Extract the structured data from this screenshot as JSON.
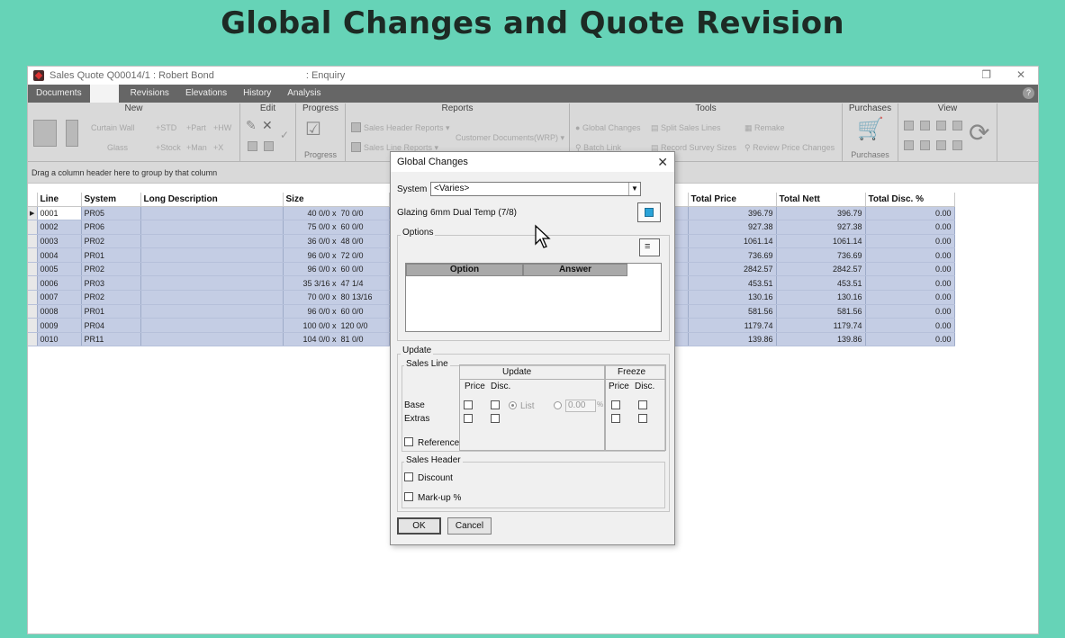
{
  "slide": {
    "title": "Global Changes and Quote Revision"
  },
  "window": {
    "title": "Sales Quote Q00014/1 : Robert Bond",
    "mode": ": Enquiry"
  },
  "menu": [
    "Documents",
    "",
    "Revisions",
    "Elevations",
    "History",
    "Analysis"
  ],
  "ribbon": {
    "new": {
      "header": "New",
      "curtain_wall": "Curtain Wall",
      "std": "+STD",
      "part": "+Part",
      "hw": "+HW",
      "glass": "Glass",
      "stock": "+Stock",
      "man": "+Man",
      "x": "+X"
    },
    "edit": {
      "header": "Edit"
    },
    "progress": {
      "header": "Progress",
      "footer": "Progress"
    },
    "reports": {
      "header": "Reports",
      "sales_header_reports": "Sales Header Reports ▾",
      "customer_documents": "Customer Documents(WRP) ▾",
      "sales_line_reports": "Sales Line Reports ▾"
    },
    "tools": {
      "header": "Tools",
      "global_changes": "Global Changes",
      "split_sales_lines": "Split Sales Lines",
      "remake": "Remake",
      "batch_link": "Batch Link",
      "record_survey_sizes": "Record Survey Sizes",
      "review_price_changes": "Review Price Changes"
    },
    "purchases": {
      "header": "Purchases",
      "footer": "Purchases"
    },
    "view": {
      "header": "View"
    }
  },
  "grid": {
    "group_hint": "Drag a column header here to group by that column",
    "columns": [
      "Line",
      "System",
      "Long Description",
      "Size",
      "Total Price",
      "Total Nett",
      "Total Disc. %"
    ],
    "rows": [
      {
        "line": "0001",
        "system": "PR05",
        "size_w": "40 0/0 x",
        "size_h": "70 0/0",
        "price": "396.79",
        "nett": "396.79",
        "disc": "0.00"
      },
      {
        "line": "0002",
        "system": "PR06",
        "size_w": "75 0/0 x",
        "size_h": "60 0/0",
        "price": "927.38",
        "nett": "927.38",
        "disc": "0.00"
      },
      {
        "line": "0003",
        "system": "PR02",
        "size_w": "36 0/0 x",
        "size_h": "48 0/0",
        "price": "1061.14",
        "nett": "1061.14",
        "disc": "0.00"
      },
      {
        "line": "0004",
        "system": "PR01",
        "size_w": "96 0/0 x",
        "size_h": "72 0/0",
        "price": "736.69",
        "nett": "736.69",
        "disc": "0.00"
      },
      {
        "line": "0005",
        "system": "PR02",
        "size_w": "96 0/0 x",
        "size_h": "60 0/0",
        "price": "2842.57",
        "nett": "2842.57",
        "disc": "0.00"
      },
      {
        "line": "0006",
        "system": "PR03",
        "size_w": "35 3/16 x",
        "size_h": "47 1/4",
        "price": "453.51",
        "nett": "453.51",
        "disc": "0.00"
      },
      {
        "line": "0007",
        "system": "PR02",
        "size_w": "70 0/0 x",
        "size_h": "80 13/16",
        "price": "130.16",
        "nett": "130.16",
        "disc": "0.00"
      },
      {
        "line": "0008",
        "system": "PR01",
        "size_w": "96 0/0 x",
        "size_h": "60 0/0",
        "price": "581.56",
        "nett": "581.56",
        "disc": "0.00"
      },
      {
        "line": "0009",
        "system": "PR04",
        "size_w": "100 0/0 x",
        "size_h": "120 0/0",
        "price": "1179.74",
        "nett": "1179.74",
        "disc": "0.00"
      },
      {
        "line": "0010",
        "system": "PR11",
        "size_w": "104 0/0 x",
        "size_h": "81 0/0",
        "price": "139.86",
        "nett": "139.86",
        "disc": "0.00"
      }
    ]
  },
  "dialog": {
    "title": "Global Changes",
    "system_label": "System",
    "system_value": "<Varies>",
    "glazing_label": "Glazing",
    "glazing_value": "6mm Dual Temp (7/8)",
    "options_legend": "Options",
    "option_col": "Option",
    "answer_col": "Answer",
    "update_legend": "Update",
    "sales_line_legend": "Sales Line",
    "update_header": "Update",
    "freeze_header": "Freeze",
    "price": "Price",
    "disc": "Disc.",
    "base": "Base",
    "extras": "Extras",
    "list": "List",
    "pct_value": "0.00",
    "pct_sign": "%",
    "reference": "Reference",
    "sales_header_legend": "Sales Header",
    "discount": "Discount",
    "markup": "Mark-up %",
    "ok": "OK",
    "cancel": "Cancel"
  }
}
